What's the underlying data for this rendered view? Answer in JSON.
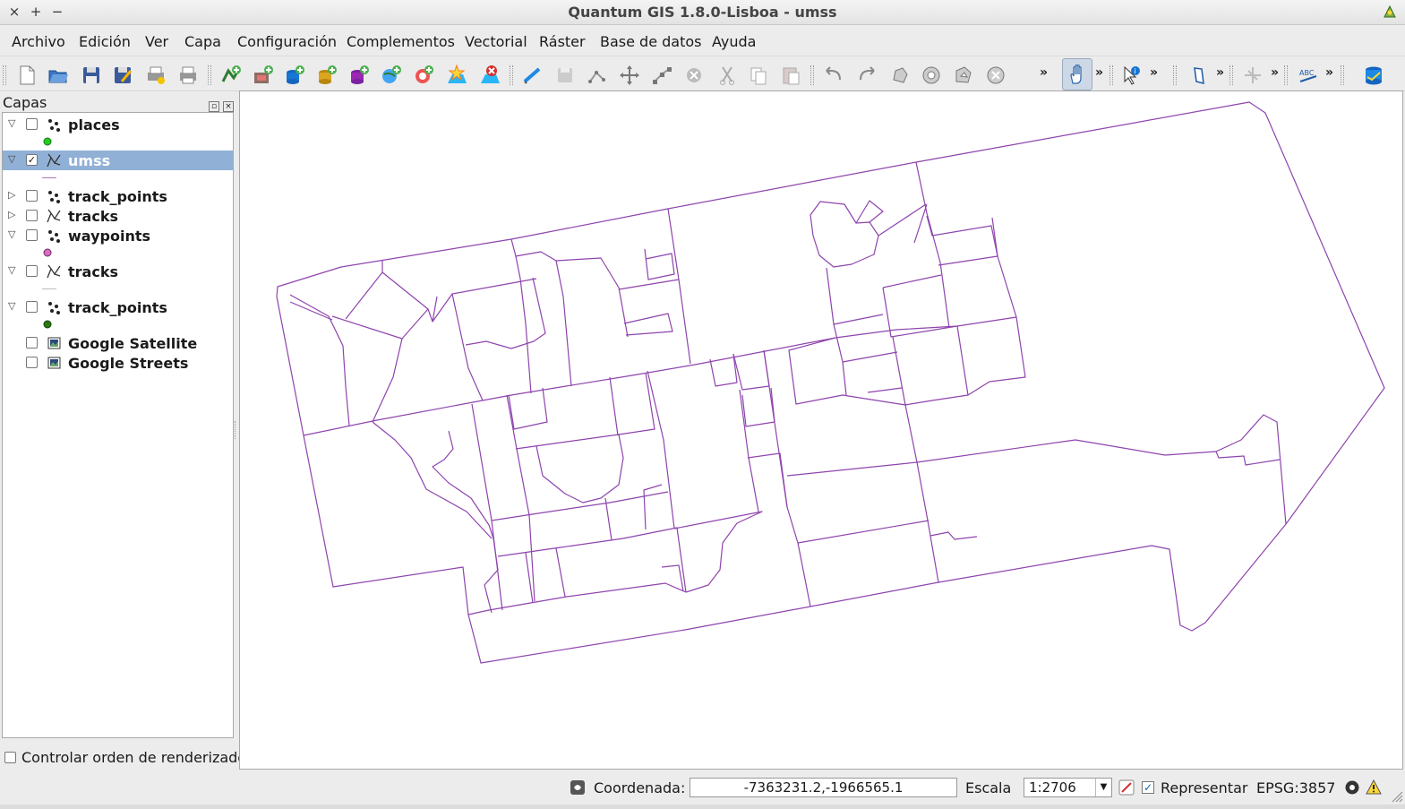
{
  "window": {
    "title": "Quantum GIS 1.8.0-Lisboa - umss",
    "close_glyph": "×",
    "max_glyph": "+",
    "min_glyph": "−"
  },
  "menu": [
    "Archivo",
    "Edición",
    "Ver",
    "Capa",
    "Configuración",
    "Complementos",
    "Vectorial",
    "Ráster",
    "Base de datos",
    "Ayuda"
  ],
  "toolbar": {
    "overflow_glyph": "»"
  },
  "layers_panel": {
    "title": "Capas",
    "layers": [
      {
        "name": "places",
        "type": "point",
        "expanded": true,
        "checked": false,
        "symbol_color": "#22cc22"
      },
      {
        "name": "umss",
        "type": "line",
        "expanded": true,
        "checked": true,
        "selected": true,
        "symbol_color": "#b070c0"
      },
      {
        "name": "track_points",
        "type": "point",
        "expanded": false,
        "checked": false
      },
      {
        "name": "tracks",
        "type": "line",
        "expanded": false,
        "checked": false
      },
      {
        "name": "waypoints",
        "type": "point",
        "expanded": true,
        "checked": false,
        "symbol_color": "#d070c0"
      },
      {
        "name": "tracks",
        "type": "line",
        "expanded": true,
        "checked": false,
        "symbol_color": "#bbbbbb"
      },
      {
        "name": "track_points",
        "type": "point",
        "expanded": true,
        "checked": false,
        "symbol_color": "#2a7a10"
      },
      {
        "name": "Google Satellite",
        "type": "raster",
        "checked": false
      },
      {
        "name": "Google Streets",
        "type": "raster",
        "checked": false
      }
    ],
    "render_order_label": "Controlar orden de renderizado"
  },
  "map": {
    "line_color": "#8e44ad"
  },
  "status": {
    "coord_label": "Coordenada:",
    "coord_value": "-7363231.2,-1966565.1",
    "scale_label": "Escala",
    "scale_value": "1:2706",
    "render_label": "Representar",
    "crs": "EPSG:3857"
  }
}
